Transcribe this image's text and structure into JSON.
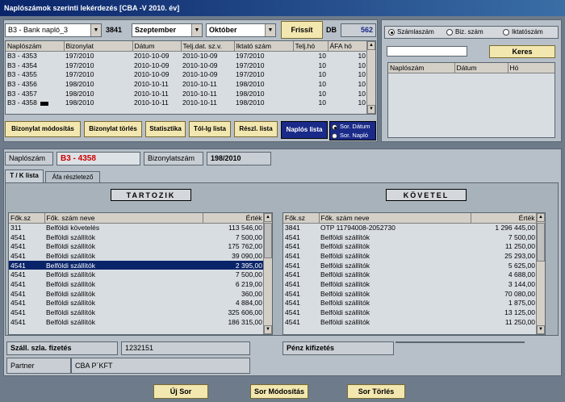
{
  "window": {
    "title": "Naplószámok szerinti lekérdezés  [CBA -V  2010. év]"
  },
  "toolbar": {
    "naplo_select": "B3 - Bank napló_3",
    "naplo_code": "3841",
    "month_from": "Szeptember",
    "month_to": "Október",
    "refresh_label": "Frissít",
    "db_label": "DB",
    "db_count": "562"
  },
  "journal_table": {
    "headers": [
      "Naplószám",
      "Bizonylat",
      "Dátum",
      "Telj.dat. sz.v.",
      "Iktató szám",
      "Telj.hó",
      "ÁFA hó"
    ],
    "rows": [
      [
        "B3 - 4353",
        "197/2010",
        "2010-10-09",
        "2010-10-09",
        "197/2010",
        "10",
        "10"
      ],
      [
        "B3 - 4354",
        "197/2010",
        "2010-10-09",
        "2010-10-09",
        "197/2010",
        "10",
        "10"
      ],
      [
        "B3 - 4355",
        "197/2010",
        "2010-10-09",
        "2010-10-09",
        "197/2010",
        "10",
        "10"
      ],
      [
        "B3 - 4356",
        "198/2010",
        "2010-10-11",
        "2010-10-11",
        "198/2010",
        "10",
        "10"
      ],
      [
        "B3 - 4357",
        "198/2010",
        "2010-10-11",
        "2010-10-11",
        "198/2010",
        "10",
        "10"
      ],
      [
        "B3 - 4358",
        "198/2010",
        "2010-10-11",
        "2010-10-11",
        "198/2010",
        "10",
        "10"
      ]
    ]
  },
  "actions": {
    "modify": "Bizonylat módosítás",
    "delete": "Bizonylat törlés",
    "stats": "Statisztika",
    "range": "Tól-Ig lista",
    "partial": "Részl. lista",
    "journal_list": "Naplós lista",
    "sort_date": "Sor. Dátum",
    "sort_journal": "Sor. Napló"
  },
  "search": {
    "opt_account": "Számlaszám",
    "opt_bizszam": "Biz. szám",
    "opt_iktato": "Iktatószám",
    "button": "Keres",
    "headers": [
      "Naplószám",
      "Dátum",
      "Hó"
    ]
  },
  "detail": {
    "naplo_label": "Naplószám",
    "naplo_value": "B3 - 4358",
    "biz_label": "Bizonylatszám",
    "biz_value": "198/2010"
  },
  "tabs": [
    "T / K lista",
    "Áfa részletező"
  ],
  "debit": {
    "title": "TARTOZIK",
    "headers": [
      "Fők.sz",
      "Fők. szám neve",
      "Érték"
    ],
    "rows": [
      [
        "311",
        "Belföldi követelés",
        "113 546,00"
      ],
      [
        "4541",
        "Belföldi szállítók",
        "7 500,00"
      ],
      [
        "4541",
        "Belföldi szállítók",
        "175 762,00"
      ],
      [
        "4541",
        "Belföldi szállítók",
        "39 090,00"
      ],
      [
        "4541",
        "Belföldi szállítók",
        "2 395,00"
      ],
      [
        "4541",
        "Belföldi szállítók",
        "7 500,00"
      ],
      [
        "4541",
        "Belföldi szállítók",
        "6 219,00"
      ],
      [
        "4541",
        "Belföldi szállítók",
        "360,00"
      ],
      [
        "4541",
        "Belföldi szállítók",
        "4 884,00"
      ],
      [
        "4541",
        "Belföldi szállítók",
        "325 606,00"
      ],
      [
        "4541",
        "Belföldi szállítók",
        "186 315,00"
      ]
    ]
  },
  "credit": {
    "title": "KÖVETEL",
    "headers": [
      "Fők.sz",
      "Fők. szám neve",
      "Érték"
    ],
    "rows": [
      [
        "3841",
        "OTP 11794008-2052730",
        "1 296 445,00"
      ],
      [
        "4541",
        "Belföldi szállítók",
        "7 500,00"
      ],
      [
        "4541",
        "Belföldi szállítók",
        "11 250,00"
      ],
      [
        "4541",
        "Belföldi szállítók",
        "25 293,00"
      ],
      [
        "4541",
        "Belföldi szállítók",
        "5 625,00"
      ],
      [
        "4541",
        "Belföldi szállítók",
        "4 688,00"
      ],
      [
        "4541",
        "Belföldi szállítók",
        "3 144,00"
      ],
      [
        "4541",
        "Belföldi szállítók",
        "70 080,00"
      ],
      [
        "4541",
        "Belföldi szállítók",
        "1 875,00"
      ],
      [
        "4541",
        "Belföldi szállítók",
        "13 125,00"
      ],
      [
        "4541",
        "Belföldi szállítók",
        "11 250,00"
      ]
    ]
  },
  "info": {
    "szall_label": "Száll. szla. fizetés",
    "szall_value": "1232151",
    "partner_label": "Partner",
    "partner_value": "CBA P´KFT",
    "penz_label": "Pénz kifizetés"
  },
  "bottom": {
    "new": "Új Sor",
    "modify": "Sor Módosítás",
    "delete": "Sor Törlés"
  },
  "colors": {
    "title_bar": "#0a246a",
    "button": "#f3e7b0",
    "selected_row": "#0a246a",
    "red_value": "#cc0000"
  }
}
